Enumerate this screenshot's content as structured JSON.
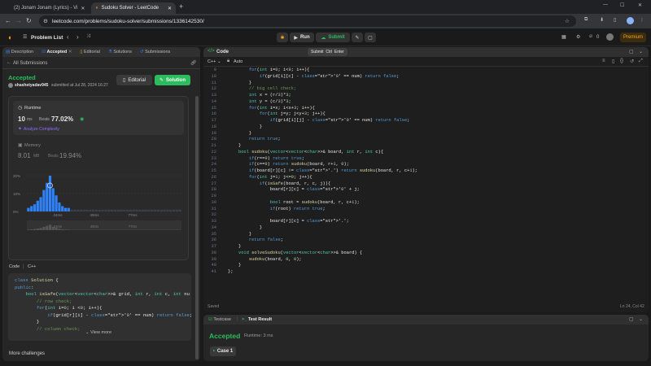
{
  "browser": {
    "tabs": [
      {
        "title": "(2) Jonam Jonam (Lyrics) - Vi",
        "active": false
      },
      {
        "title": "Sudoku Solver - LeetCode",
        "active": true
      }
    ],
    "url": "leetcode.com/problems/sudoku-solver/submissions/1336142530/"
  },
  "nav": {
    "problem_list": "Problem List",
    "run": "Run",
    "submit": "Submit",
    "streak": "0",
    "premium": "Premium"
  },
  "left_tabs": {
    "description": "Description",
    "accepted": "Accepted",
    "editorial": "Editorial",
    "solutions": "Solutions",
    "submissions": "Submissions"
  },
  "submission": {
    "back": "All Submissions",
    "status": "Accepted",
    "status_detail": "",
    "user": "shashetyadav945",
    "submitted_text": "submitted at Jul 28, 2024 16:27",
    "editorial_btn": "Editorial",
    "solution_btn": "Solution",
    "runtime_label": "Runtime",
    "runtime_value": "10",
    "runtime_unit": "ms",
    "beats_label": "Beats",
    "runtime_beats": "77.02%",
    "analyze": "Analyze Complexity",
    "memory_label": "Memory",
    "memory_value": "8.01",
    "memory_unit": "MB",
    "memory_beats": "19.94%",
    "chart_ylabels": [
      "30%",
      "20%",
      "10%",
      "0%"
    ],
    "chart_xlabels": [
      "24ms",
      "49ms",
      "77ms"
    ],
    "code_lang_label": "Code",
    "code_lang": "C++",
    "preview_lines": [
      "class Solution {",
      "public:",
      "    bool isSafe(vector<vector<char>>& grid, int r, int c, int nu",
      "        // row check;",
      "        for(int i=0; i <9; i++){",
      "            if(grid[r][i] - '0' == num) return false;",
      "        }",
      "        // column check;"
    ],
    "view_more": "View more",
    "more_challenges": "More challenges"
  },
  "chart_data": {
    "type": "bar",
    "title": "",
    "xlabel": "",
    "ylabel": "",
    "ylim": [
      0,
      30
    ],
    "x_tick_labels": [
      "24ms",
      "49ms",
      "77ms"
    ],
    "values": [
      2,
      3,
      4,
      6,
      8,
      12,
      16,
      20,
      13,
      9,
      5,
      3,
      2,
      2,
      1,
      1,
      1,
      1,
      1,
      1,
      1,
      1,
      1,
      1,
      1,
      1,
      1,
      1,
      1,
      1,
      1,
      1,
      1,
      1,
      1,
      1,
      1,
      1,
      1,
      1,
      1,
      1,
      1,
      1,
      1,
      1,
      1,
      1,
      1,
      1
    ],
    "highlight_index": 7
  },
  "editor": {
    "header": "Code",
    "lang": "C++",
    "auto": "Auto",
    "tooltip": "Submit  Ctrl  Enter",
    "status_left": "Saved",
    "status_right": "Ln 24, Col 42",
    "start_line": 9,
    "lines": [
      "        for(int i=0; i<9; i++){",
      "            if(grid[i][c] - '0' == num) return false;",
      "        }",
      "        // big cell check;",
      "        int x = (r/3)*3;",
      "        int y = (c/3)*3;",
      "        for(int i=x; i<x+3; i++){",
      "            for(int j=y; j<y+3; j++){",
      "                if(grid[i][j] - '0' == num) return false;",
      "            }",
      "        }",
      "        return true;",
      "    }",
      "    bool sudoku(vector<vector<char>>& board, int r, int c){",
      "        if(r==9) return true;",
      "        if(c==9) return sudoku(board, r+1, 0);",
      "        if(board[r][c] != '.') return sudoku(board, r, c+1);",
      "        for(int j=1; j<=9; j++){",
      "            if(isSafe(board, r, c, j)){",
      "                board[r][c] = '0' + j;",
      "",
      "                bool root = sudoku(board, r, c+1);",
      "                if(root) return true;",
      "",
      "                board[r][c] = '.';",
      "            }",
      "        }",
      "        return false;",
      "    }",
      "    void solveSudoku(vector<vector<char>>& board) {",
      "        sudoku(board, 0, 0);",
      "    }",
      "};"
    ]
  },
  "test": {
    "testcase_tab": "Testcase",
    "result_tab": "Test Result",
    "status": "Accepted",
    "runtime": "Runtime: 3 ms",
    "case": "Case 1"
  },
  "colors": {
    "accent_green": "#2cbb5d",
    "orange": "#ffa116",
    "blue": "#3b82f6"
  }
}
